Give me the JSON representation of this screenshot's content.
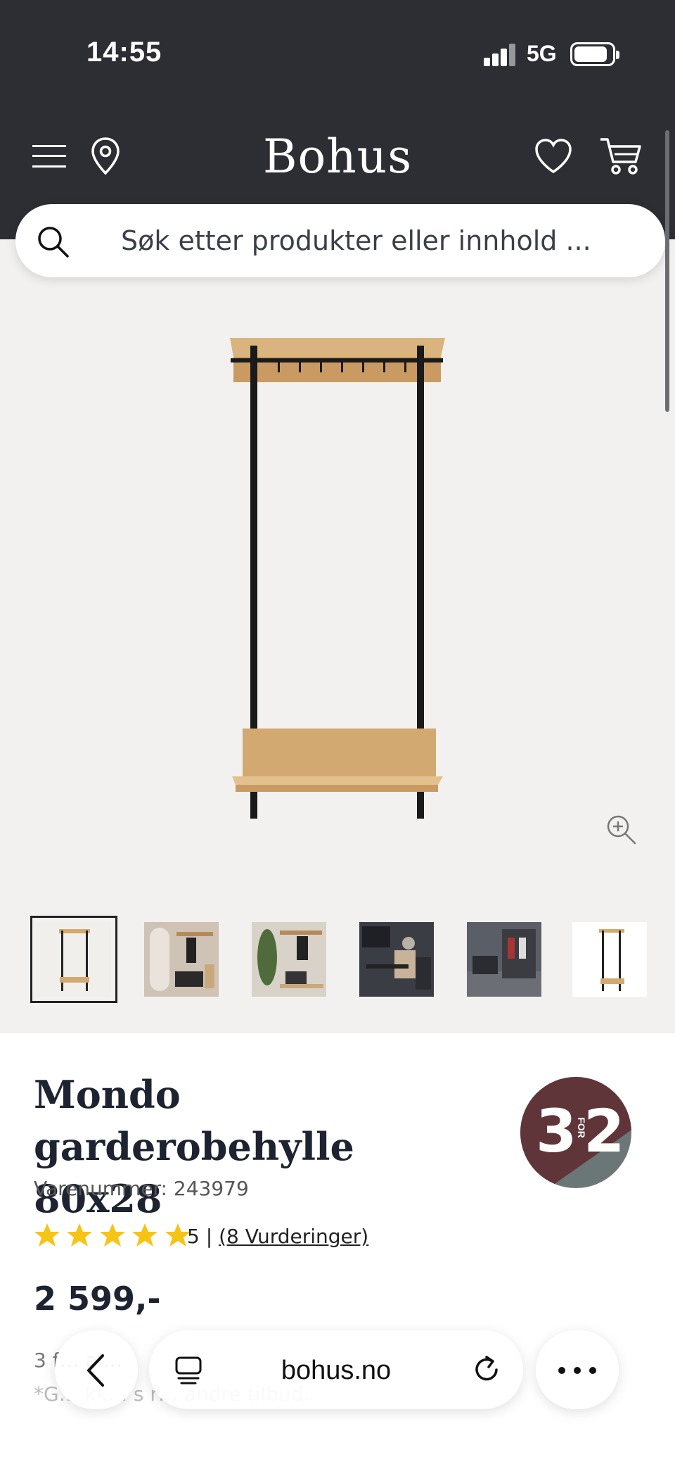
{
  "status_bar": {
    "time": "14:55",
    "network": "5G"
  },
  "header": {
    "logo": "Bohus"
  },
  "search": {
    "placeholder": "Søk etter produkter eller innhold ..."
  },
  "thumbnails": [
    "Produktbilde 1",
    "Produktbilde 2",
    "Produktbilde 3",
    "Produktbilde 4",
    "Produktbilde 5",
    "Produktbilde 6"
  ],
  "product": {
    "title": "Mondo garderobehylle 80x28",
    "varenummer": "Varenummer: 243979",
    "badge": {
      "left": "3",
      "middle": "FOR",
      "right": "2"
    },
    "rating_value": "5",
    "rating_separator": "|",
    "rating_count": "(8 Vurderinger)",
    "stars": 5,
    "price": "2 599,-",
    "offer_line": "3 f… al…",
    "fine_print": "*G… kk… s r… andre tilbud."
  },
  "browser": {
    "url": "bohus.no"
  },
  "colors": {
    "header_bg": "#2d2e33",
    "page_bg": "#f3f1ef",
    "star": "#f6c417",
    "badge_top": "#5f3539",
    "badge_bottom": "#6b7776"
  }
}
